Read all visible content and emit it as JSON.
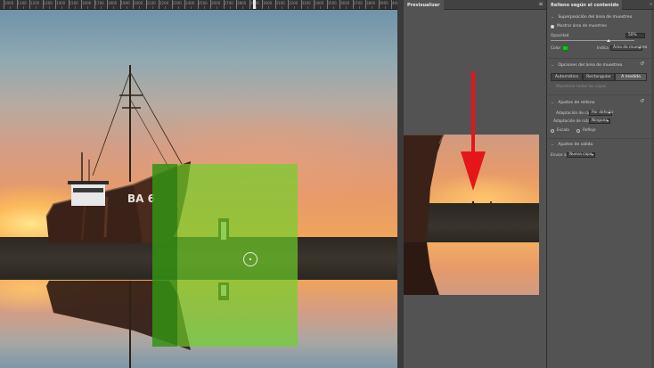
{
  "ruler": {
    "labels": [
      "1000",
      "1100",
      "1200",
      "1300",
      "1400",
      "1500",
      "1600",
      "1700",
      "1800",
      "1900",
      "2000",
      "2100",
      "2200",
      "2300",
      "2400",
      "2500",
      "2600",
      "2700",
      "2800",
      "2900",
      "3000",
      "3100",
      "3200",
      "3300",
      "3400",
      "3500",
      "3600",
      "3700",
      "3800",
      "3900",
      "4000"
    ]
  },
  "preview": {
    "tab_label": "Previsualizar",
    "menu_icon": "menu-icon"
  },
  "properties": {
    "tab_label": "Relleno según el contenido",
    "collapse_icon": "collapse-icon",
    "overlay_section": {
      "title": "Superposición del área de muestreo",
      "show_checkbox_label": "Mostrar área de muestreo",
      "show_checked": true,
      "opacity_label": "Opacidad",
      "opacity_value": "50%",
      "opacity_level": 0.5,
      "color_label": "Color",
      "color_value": "#1dbf1d",
      "indicates_label": "Indica",
      "indicates_value": "Área de muestreo"
    },
    "sampling_section": {
      "title": "Opciones del área de muestreo",
      "buttons": [
        "Automático",
        "Rectangular",
        "A medida"
      ],
      "active_button": "A medida",
      "sample_all_layers": "Muestrear todas las capas"
    },
    "fill_section": {
      "title": "Ajustes de relleno",
      "color_adapt_label": "Adaptación de color",
      "color_adapt_value": "Por defecto",
      "rotation_adapt_label": "Adaptación de rotación",
      "rotation_adapt_value": "Ninguna",
      "scale_label": "Escala",
      "mirror_label": "Reflejo"
    },
    "output_section": {
      "title": "Ajustes de salida",
      "output_label": "Enviar a",
      "output_value": "Nueva capa"
    }
  }
}
